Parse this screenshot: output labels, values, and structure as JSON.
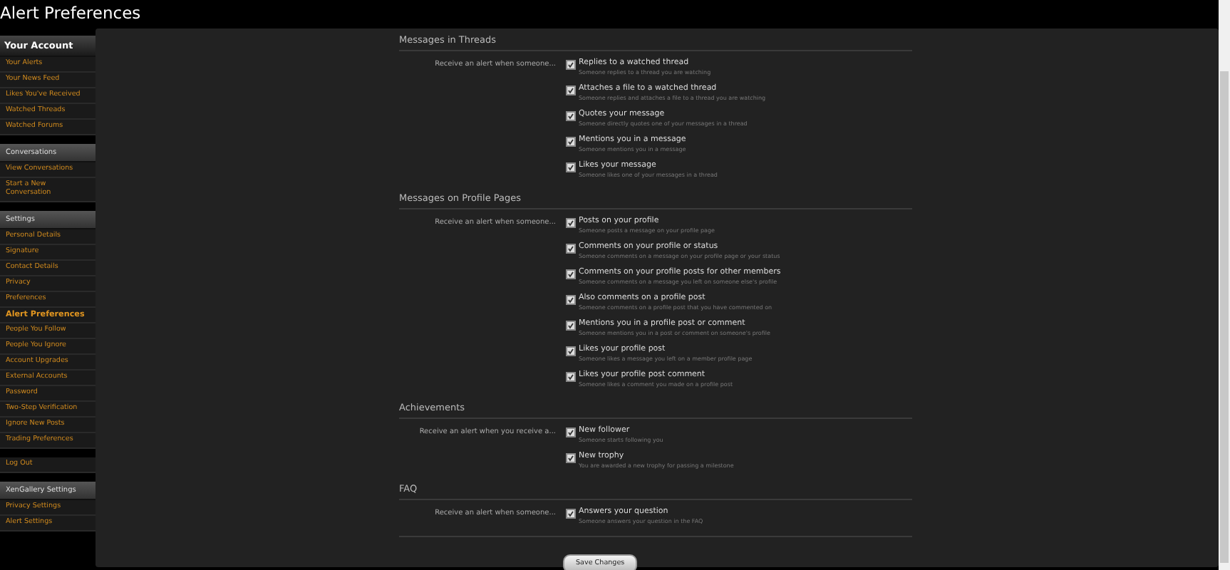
{
  "page_title": "Alert Preferences",
  "sidebar": {
    "sections": [
      {
        "heading": "Your Account",
        "items": [
          {
            "label": "Your Alerts",
            "selected": false
          },
          {
            "label": "Your News Feed",
            "selected": false
          },
          {
            "label": "Likes You've Received",
            "selected": false
          },
          {
            "label": "Watched Threads",
            "selected": false
          },
          {
            "label": "Watched Forums",
            "selected": false
          }
        ]
      },
      {
        "heading": "Conversations",
        "items": [
          {
            "label": "View Conversations",
            "selected": false
          },
          {
            "label": "Start a New Conversation",
            "selected": false
          }
        ]
      },
      {
        "heading": "Settings",
        "items": [
          {
            "label": "Personal Details",
            "selected": false
          },
          {
            "label": "Signature",
            "selected": false
          },
          {
            "label": "Contact Details",
            "selected": false
          },
          {
            "label": "Privacy",
            "selected": false
          },
          {
            "label": "Preferences",
            "selected": false
          },
          {
            "label": "Alert Preferences",
            "selected": true
          },
          {
            "label": "People You Follow",
            "selected": false
          },
          {
            "label": "People You Ignore",
            "selected": false
          },
          {
            "label": "Account Upgrades",
            "selected": false
          },
          {
            "label": "External Accounts",
            "selected": false
          },
          {
            "label": "Password",
            "selected": false
          },
          {
            "label": "Two-Step Verification",
            "selected": false
          },
          {
            "label": "Ignore New Posts",
            "selected": false
          },
          {
            "label": "Trading Preferences",
            "selected": false
          }
        ]
      },
      {
        "items": [
          {
            "label": "Log Out",
            "selected": false
          }
        ]
      },
      {
        "heading": "XenGallery Settings",
        "items": [
          {
            "label": "Privacy Settings",
            "selected": false
          },
          {
            "label": "Alert Settings",
            "selected": false
          }
        ]
      }
    ]
  },
  "form": {
    "sections": [
      {
        "heading": "Messages in Threads",
        "prompt": "Receive an alert when someone...",
        "options": [
          {
            "label": "Replies to a watched thread",
            "description": "Someone replies to a thread you are watching",
            "checked": true
          },
          {
            "label": "Attaches a file to a watched thread",
            "description": "Someone replies and attaches a file to a thread you are watching",
            "checked": true
          },
          {
            "label": "Quotes your message",
            "description": "Someone directly quotes one of your messages in a thread",
            "checked": true
          },
          {
            "label": "Mentions you in a message",
            "description": "Someone mentions you in a message",
            "checked": true
          },
          {
            "label": "Likes your message",
            "description": "Someone likes one of your messages in a thread",
            "checked": true
          }
        ]
      },
      {
        "heading": "Messages on Profile Pages",
        "prompt": "Receive an alert when someone...",
        "options": [
          {
            "label": "Posts on your profile",
            "description": "Someone posts a message on your profile page",
            "checked": true
          },
          {
            "label": "Comments on your profile or status",
            "description": "Someone comments on a message on your profile page or your status",
            "checked": true
          },
          {
            "label": "Comments on your profile posts for other members",
            "description": "Someone comments on a message you left on someone else's profile",
            "checked": true
          },
          {
            "label": "Also comments on a profile post",
            "description": "Someone comments on a profile post that you have commented on",
            "checked": true
          },
          {
            "label": "Mentions you in a profile post or comment",
            "description": "Someone mentions you in a post or comment on someone's profile",
            "checked": true
          },
          {
            "label": "Likes your profile post",
            "description": "Someone likes a message you left on a member profile page",
            "checked": true
          },
          {
            "label": "Likes your profile post comment",
            "description": "Someone likes a comment you made on a profile post",
            "checked": true
          }
        ]
      },
      {
        "heading": "Achievements",
        "prompt": "Receive an alert when you receive a...",
        "options": [
          {
            "label": "New follower",
            "description": "Someone starts following you",
            "checked": true
          },
          {
            "label": "New trophy",
            "description": "You are awarded a new trophy for passing a milestone",
            "checked": true
          }
        ]
      },
      {
        "heading": "FAQ",
        "prompt": "Receive an alert when someone...",
        "options": [
          {
            "label": "Answers your question",
            "description": "Someone answers your question in the FAQ",
            "checked": true
          }
        ]
      }
    ],
    "save_button": "Save Changes"
  }
}
